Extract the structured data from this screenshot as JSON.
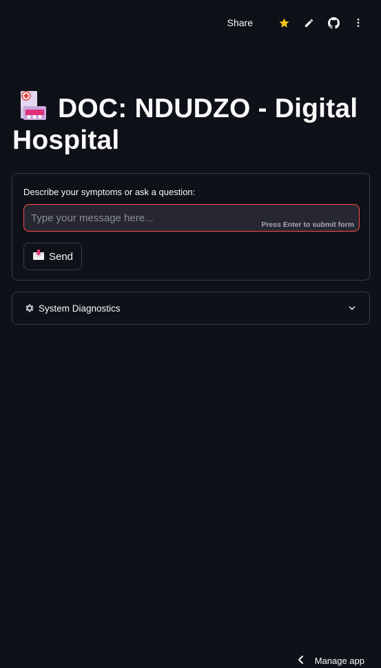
{
  "header": {
    "share_label": "Share",
    "icons": [
      "star-icon",
      "pencil-icon",
      "github-icon",
      "more-vertical-icon"
    ],
    "star_color": "#f5c518"
  },
  "title": {
    "emoji": "hospital-building-emoji",
    "text": "DOC: NDUDZO - Digital Hospital"
  },
  "form": {
    "label": "Describe your symptoms or ask a question:",
    "input_value": "",
    "input_placeholder": "Type your message here...",
    "hint": "Press Enter to submit form",
    "send_label": "Send",
    "send_icon": "envelope-icon",
    "accent_color": "#ff4b4b"
  },
  "expander": {
    "icon": "gear-icon",
    "label": "System Diagnostics",
    "expanded": false
  },
  "footer": {
    "manage_label": "Manage app"
  }
}
